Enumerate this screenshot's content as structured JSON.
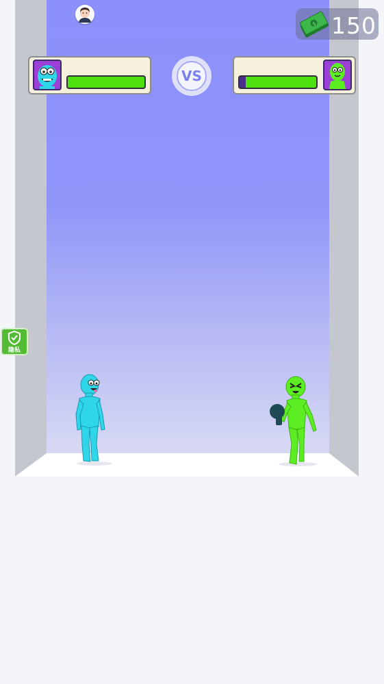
{
  "hud": {
    "money_amount": "150",
    "vs_label": "VS",
    "privacy_label": "隐私"
  },
  "player": {
    "character": "blue-monster",
    "health_fraction": 1.0,
    "color": "#2fd6e8"
  },
  "enemy": {
    "character": "green-monster",
    "health_fraction": 0.92,
    "color": "#5cee22"
  },
  "icons": [
    "avatar-icon",
    "cash-icon",
    "shield-icon"
  ],
  "colors": {
    "health_fill": "#4ee10f",
    "health_empty": "#4b2f8c",
    "back_wall": "#8b90fb",
    "portrait_bg": "#9b3fd7",
    "privacy_badge": "#54bb34"
  }
}
